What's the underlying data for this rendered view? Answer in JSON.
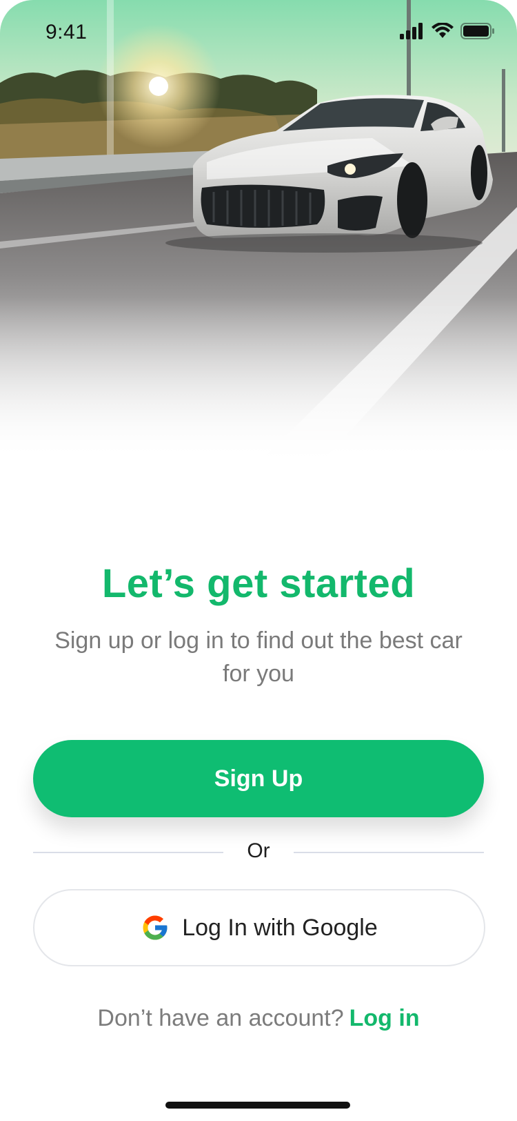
{
  "status_bar": {
    "time": "9:41",
    "icons": [
      "cellular-signal-icon",
      "wifi-icon",
      "battery-icon"
    ]
  },
  "hero": {
    "image": "sports-car-on-highway-photo"
  },
  "onboarding": {
    "title": "Let’s get started",
    "subtitle": "Sign up or log in to find out the best car for you",
    "signup_label": "Sign Up",
    "divider_text": "Or",
    "google_label": "Log In with Google",
    "google_icon": "google-icon",
    "no_account_text": "Don’t have an account?",
    "login_link": "Log in"
  },
  "colors": {
    "accent": "#0fbd72",
    "accent_text": "#13b86c",
    "muted_text": "#7a7a7a",
    "hero_sky": "#8fdcb3"
  }
}
